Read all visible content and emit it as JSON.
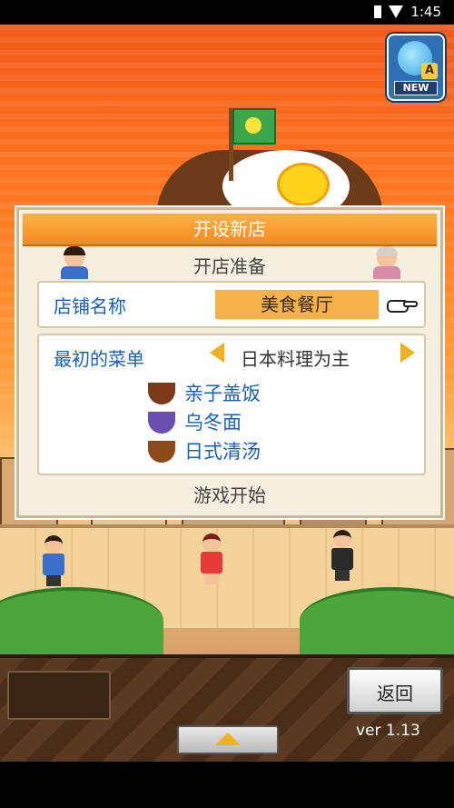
{
  "status_bar": {
    "time": "1:45"
  },
  "app_icon": {
    "badge": "NEW",
    "letter": "A"
  },
  "dialog": {
    "title": "开设新店",
    "subtitle": "开店准备",
    "shop_name_label": "店铺名称",
    "shop_name_value": "美食餐厅",
    "menu_label": "最初的菜单",
    "cuisine": "日本料理为主",
    "menu_items": [
      {
        "name": "亲子盖饭",
        "icon": "oyakodon-icon"
      },
      {
        "name": "乌冬面",
        "icon": "udon-icon"
      },
      {
        "name": "日式清汤",
        "icon": "clear-soup-icon"
      }
    ],
    "start_label": "游戏开始"
  },
  "bottom": {
    "back_label": "返回",
    "version": "ver 1.13"
  }
}
